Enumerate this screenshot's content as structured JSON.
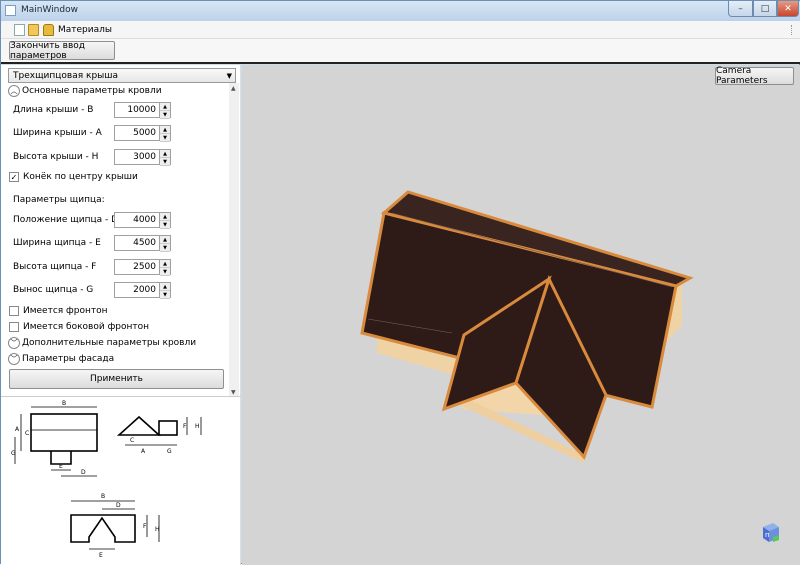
{
  "window": {
    "title": "MainWindow",
    "min": "–",
    "max": "□",
    "close": "✕"
  },
  "menu": {
    "label": "Материалы",
    "icons": [
      "new-doc-icon",
      "open-folder-icon",
      "lock-icon"
    ]
  },
  "toolbar": {
    "finish_label": "Закончить ввод параметров"
  },
  "sidebar": {
    "roof_type": "Трехщипцовая крыша",
    "main_section": "Основные параметры кровли",
    "fields_main": [
      {
        "label": "Длина крыши - B",
        "value": "10000"
      },
      {
        "label": "Ширина крыши - A",
        "value": "5000"
      },
      {
        "label": "Высота крыши - H",
        "value": "3000"
      }
    ],
    "ridge_center": {
      "label": "Конёк по центру крыши",
      "checked": true
    },
    "gable_params": "Параметры щипца:",
    "fields_gable": [
      {
        "label": "Положение щипца - D",
        "value": "4000"
      },
      {
        "label": "Ширина щипца - E",
        "value": "4500"
      },
      {
        "label": "Высота щипца - F",
        "value": "2500"
      },
      {
        "label": "Вынос щипца - G",
        "value": "2000"
      }
    ],
    "has_front": {
      "label": "Имеется фронтон",
      "checked": false
    },
    "has_side_front": {
      "label": "Имеется боковой фронтон",
      "checked": false
    },
    "extra_section": "Дополнительные параметры кровли",
    "facade_section": "Параметры фасада",
    "apply_label": "Применить"
  },
  "diagram_labels": {
    "a": "A",
    "b": "B",
    "c": "C",
    "d": "D",
    "e": "E",
    "f": "F",
    "g": "G",
    "h": "H"
  },
  "viewport": {
    "camera_label": "Camera Parameters",
    "background": "#d4d4d4",
    "roof_color": "#2e1a16",
    "edge_color": "#d98a3c",
    "wall_color": "#f0d3a5"
  }
}
